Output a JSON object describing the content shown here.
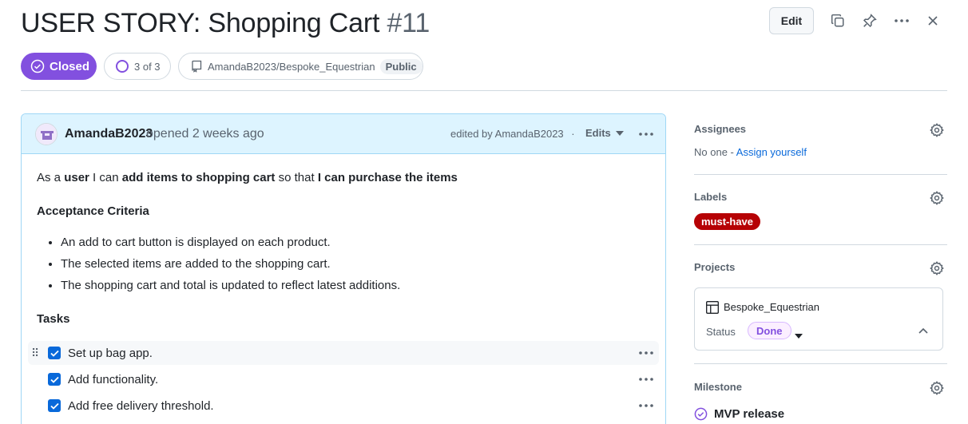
{
  "header": {
    "title": "USER STORY: Shopping Cart",
    "number": "#11",
    "edit_label": "Edit",
    "state": "Closed",
    "progress": "3 of 3",
    "repo": "AmandaB2023/Bespoke_Equestrian",
    "visibility": "Public"
  },
  "comment": {
    "author": "AmandaB2023",
    "opened_text": "opened 2 weeks ago",
    "edited_text": "edited by AmandaB2023",
    "separator": "·",
    "edits_label": "Edits",
    "story": {
      "as_a": "As a",
      "role": "user",
      "i_can": "I can",
      "action": "add items to shopping cart",
      "so_that": "so that",
      "benefit": "I can purchase the items"
    },
    "acceptance_heading": "Acceptance Criteria",
    "criteria": [
      "An add to cart button is displayed on each product.",
      "The selected items are added to the shopping cart.",
      "The shopping cart and total is updated to reflect latest additions."
    ],
    "tasks_heading": "Tasks",
    "tasks": [
      {
        "label": "Set up bag app.",
        "checked": true
      },
      {
        "label": "Add functionality.",
        "checked": true
      },
      {
        "label": "Add free delivery threshold.",
        "checked": true
      }
    ]
  },
  "sidebar": {
    "assignees": {
      "title": "Assignees",
      "none": "No one -",
      "assign_link": "Assign yourself"
    },
    "labels": {
      "title": "Labels",
      "items": [
        {
          "name": "must-have",
          "color": "#b60205"
        }
      ]
    },
    "projects": {
      "title": "Projects",
      "project_name": "Bespoke_Equestrian",
      "status_label": "Status",
      "status_value": "Done"
    },
    "milestone": {
      "title": "Milestone",
      "name": "MVP release"
    }
  },
  "colors": {
    "accent": "#0969da",
    "closed": "#8250df",
    "label_must_have": "#b60205"
  }
}
